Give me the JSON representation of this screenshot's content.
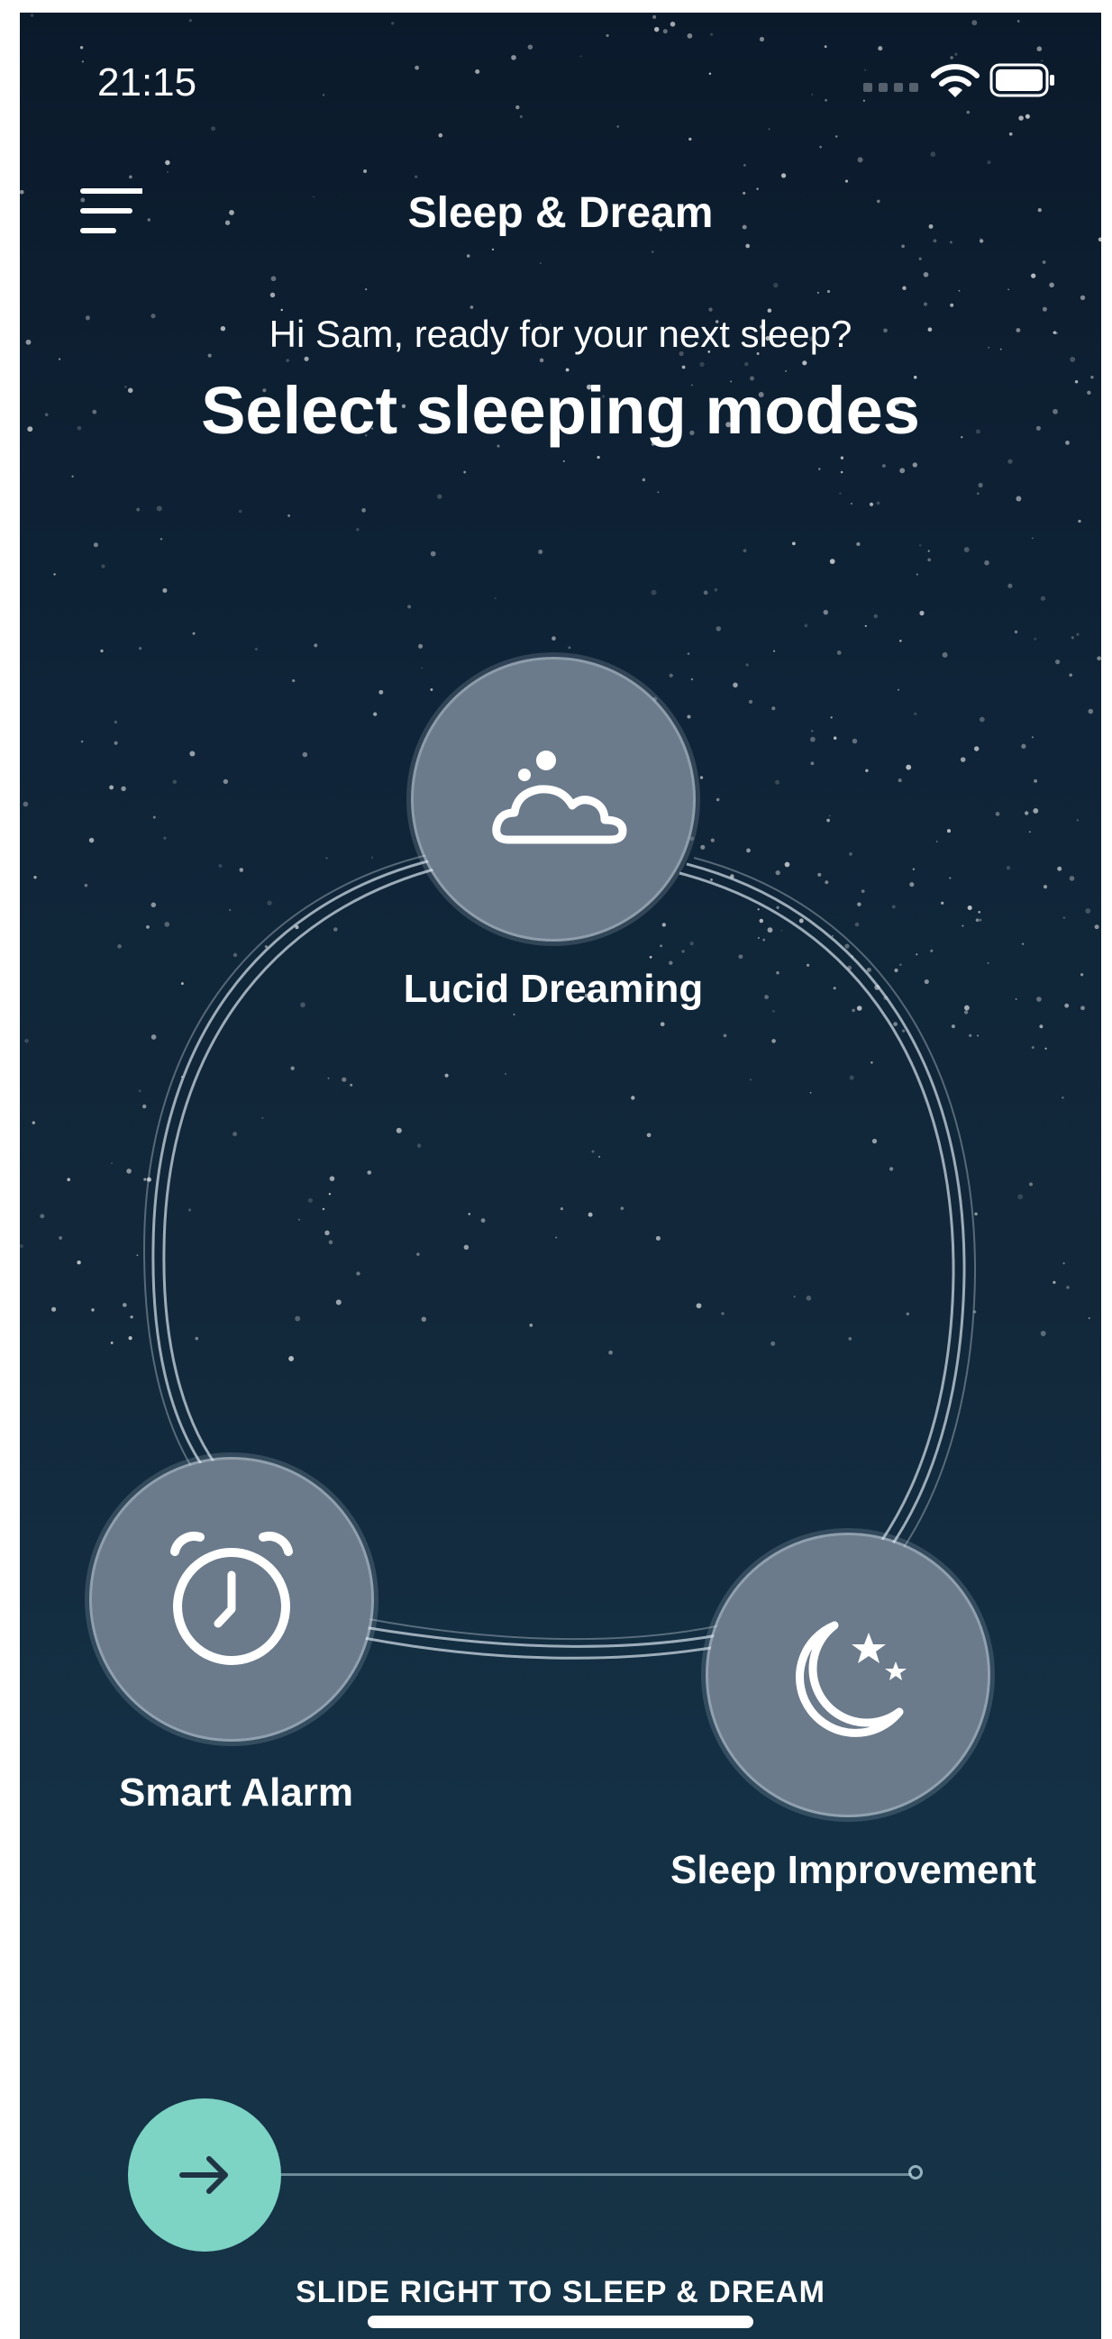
{
  "status_bar": {
    "time": "21:15",
    "icons": [
      "cellular-signal-icon",
      "wifi-icon",
      "battery-icon"
    ]
  },
  "header": {
    "menu_icon": "hamburger-menu-icon",
    "title": "Sleep & Dream"
  },
  "intro": {
    "greeting": "Hi Sam, ready for your next sleep?",
    "heading": "Select sleeping modes"
  },
  "modes": [
    {
      "label": "Lucid Dreaming",
      "icon": "cloud-moon-icon"
    },
    {
      "label": "Smart Alarm",
      "icon": "alarm-clock-icon"
    },
    {
      "label": "Sleep Improvement",
      "icon": "moon-stars-icon"
    }
  ],
  "slider": {
    "label": "SLIDE RIGHT TO SLEEP & DREAM",
    "icon": "arrow-right-icon",
    "progress": 0
  },
  "colors": {
    "background_top": "#0b1a2b",
    "background_bottom": "#163447",
    "mode_bubble": "#6b7b8c",
    "slider_handle": "#7dd3c4",
    "text": "#ffffff"
  }
}
